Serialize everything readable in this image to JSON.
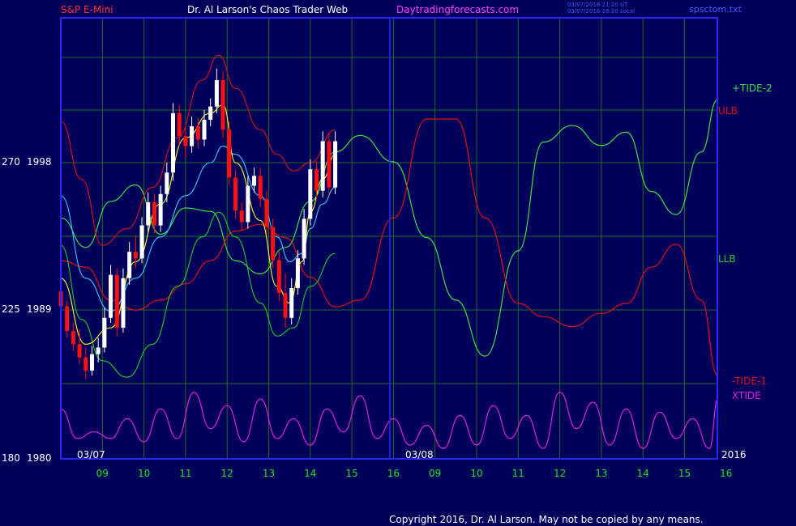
{
  "header": {
    "instrument": "S&P E-Mini",
    "site": "Dr. Al Larson's Chaos Trader Web",
    "url": "Daytradingforecasts.com",
    "update_line1": "03/07/2016 21:20 UT",
    "update_line2": "03/07/2016 16:20 Local",
    "file": "spsctom.txt"
  },
  "copyright": "Copyright 2016, Dr. Al Larson. May not be copied by any means.",
  "colors": {
    "background": "#00005a",
    "frame": "#2828ff",
    "grid": "#1f6f1f",
    "up_bar": "#ffffff",
    "down_bar": "#ff1010",
    "ulb": "#e01010",
    "llb": "#20d020",
    "tide_plus": "#40e040",
    "tide_minus": "#e01010",
    "xtide": "#e020e0",
    "yellow_ma": "#ffff20",
    "cyan_ma": "#40c8ff",
    "x_tick_text": "#20e020",
    "header_red": "#ff3030",
    "header_white": "#ffffff",
    "header_magenta": "#ff40ff",
    "header_blue": "#4060ff"
  },
  "chart_data": {
    "type": "line",
    "title": "S&P E-Mini",
    "y_axis": {
      "ticks": [
        {
          "left": "270",
          "right": "1998"
        },
        {
          "left": "225",
          "right": "1989"
        },
        {
          "left": "180",
          "right": "1980"
        }
      ]
    },
    "x_axis": {
      "date_labels": [
        "03/07",
        "03/08"
      ],
      "year_label": "2016",
      "hour_ticks": [
        "09",
        "10",
        "11",
        "12",
        "13",
        "14",
        "15",
        "16",
        "09",
        "10",
        "11",
        "12",
        "13",
        "14",
        "15",
        "16"
      ]
    },
    "legend": [
      "+TIDE-2",
      "ULB",
      "LLB",
      "-TIDE-1",
      "XTIDE"
    ],
    "candles": [
      {
        "t": 0.0,
        "o": 1990.2,
        "h": 1990.9,
        "l": 1988.7,
        "c": 1989.3
      },
      {
        "t": 0.15,
        "o": 1989.3,
        "h": 1989.6,
        "l": 1987.4,
        "c": 1987.8
      },
      {
        "t": 0.3,
        "o": 1987.8,
        "h": 1988.3,
        "l": 1986.6,
        "c": 1987.0
      },
      {
        "t": 0.45,
        "o": 1987.0,
        "h": 1987.9,
        "l": 1985.8,
        "c": 1986.2
      },
      {
        "t": 0.6,
        "o": 1986.2,
        "h": 1986.8,
        "l": 1984.9,
        "c": 1985.4
      },
      {
        "t": 0.75,
        "o": 1985.4,
        "h": 1986.9,
        "l": 1985.1,
        "c": 1986.4
      },
      {
        "t": 0.9,
        "o": 1986.4,
        "h": 1987.4,
        "l": 1985.9,
        "c": 1986.8
      },
      {
        "t": 1.05,
        "o": 1986.8,
        "h": 1989.2,
        "l": 1986.5,
        "c": 1988.6
      },
      {
        "t": 1.2,
        "o": 1988.6,
        "h": 1991.8,
        "l": 1988.3,
        "c": 1991.2
      },
      {
        "t": 1.35,
        "o": 1991.2,
        "h": 1991.6,
        "l": 1987.5,
        "c": 1988.0
      },
      {
        "t": 1.5,
        "o": 1988.0,
        "h": 1991.6,
        "l": 1987.7,
        "c": 1991.0
      },
      {
        "t": 1.65,
        "o": 1991.0,
        "h": 1993.2,
        "l": 1990.6,
        "c": 1992.6
      },
      {
        "t": 1.8,
        "o": 1992.6,
        "h": 1993.6,
        "l": 1991.6,
        "c": 1992.2
      },
      {
        "t": 1.95,
        "o": 1992.2,
        "h": 1994.7,
        "l": 1991.9,
        "c": 1994.2
      },
      {
        "t": 2.1,
        "o": 1994.2,
        "h": 1996.2,
        "l": 1993.8,
        "c": 1995.6
      },
      {
        "t": 2.25,
        "o": 1995.6,
        "h": 1996.1,
        "l": 1993.7,
        "c": 1994.2
      },
      {
        "t": 2.4,
        "o": 1994.2,
        "h": 1996.6,
        "l": 1993.8,
        "c": 1996.1
      },
      {
        "t": 2.55,
        "o": 1996.1,
        "h": 1998.0,
        "l": 1995.6,
        "c": 1997.4
      },
      {
        "t": 2.7,
        "o": 1997.4,
        "h": 2001.6,
        "l": 1996.9,
        "c": 2001.0
      },
      {
        "t": 2.85,
        "o": 2001.0,
        "h": 2001.5,
        "l": 1999.0,
        "c": 1999.6
      },
      {
        "t": 3.0,
        "o": 1999.6,
        "h": 2000.1,
        "l": 1998.3,
        "c": 1999.0
      },
      {
        "t": 3.15,
        "o": 1999.0,
        "h": 2000.8,
        "l": 1998.6,
        "c": 2000.2
      },
      {
        "t": 3.3,
        "o": 2000.2,
        "h": 2000.7,
        "l": 1998.9,
        "c": 1999.4
      },
      {
        "t": 3.45,
        "o": 1999.4,
        "h": 2001.2,
        "l": 1999.0,
        "c": 2000.6
      },
      {
        "t": 3.6,
        "o": 2000.6,
        "h": 2001.9,
        "l": 2000.2,
        "c": 2001.4
      },
      {
        "t": 3.75,
        "o": 2001.4,
        "h": 2003.7,
        "l": 2001.0,
        "c": 2003.0
      },
      {
        "t": 3.9,
        "o": 2003.0,
        "h": 2003.5,
        "l": 1999.5,
        "c": 2000.0
      },
      {
        "t": 4.05,
        "o": 2000.0,
        "h": 2000.5,
        "l": 1996.6,
        "c": 1997.1
      },
      {
        "t": 4.2,
        "o": 1997.1,
        "h": 1997.6,
        "l": 1994.6,
        "c": 1995.1
      },
      {
        "t": 4.35,
        "o": 1995.1,
        "h": 1995.6,
        "l": 1993.9,
        "c": 1994.4
      },
      {
        "t": 4.5,
        "o": 1994.4,
        "h": 1997.2,
        "l": 1994.0,
        "c": 1996.6
      },
      {
        "t": 4.65,
        "o": 1996.6,
        "h": 1997.7,
        "l": 1996.2,
        "c": 1997.2
      },
      {
        "t": 4.8,
        "o": 1997.2,
        "h": 1997.7,
        "l": 1995.3,
        "c": 1995.8
      },
      {
        "t": 4.95,
        "o": 1995.8,
        "h": 1996.3,
        "l": 1993.6,
        "c": 1994.1
      },
      {
        "t": 5.1,
        "o": 1994.1,
        "h": 1994.6,
        "l": 1991.6,
        "c": 1992.1
      },
      {
        "t": 5.25,
        "o": 1992.1,
        "h": 1992.6,
        "l": 1989.6,
        "c": 1990.1
      },
      {
        "t": 5.4,
        "o": 1990.1,
        "h": 1991.3,
        "l": 1988.0,
        "c": 1988.6
      },
      {
        "t": 5.55,
        "o": 1988.6,
        "h": 1991.0,
        "l": 1988.2,
        "c": 1990.4
      },
      {
        "t": 5.7,
        "o": 1990.4,
        "h": 1992.7,
        "l": 1990.0,
        "c": 1992.2
      },
      {
        "t": 5.85,
        "o": 1992.2,
        "h": 1995.2,
        "l": 1991.8,
        "c": 1994.6
      },
      {
        "t": 6.0,
        "o": 1994.6,
        "h": 1998.2,
        "l": 1994.2,
        "c": 1997.6
      },
      {
        "t": 6.15,
        "o": 1997.6,
        "h": 1998.1,
        "l": 1995.8,
        "c": 1996.3
      },
      {
        "t": 6.3,
        "o": 1996.3,
        "h": 1999.9,
        "l": 1995.9,
        "c": 1999.3
      },
      {
        "t": 6.45,
        "o": 1999.3,
        "h": 1999.8,
        "l": 1996.0,
        "c": 1996.5
      },
      {
        "t": 6.6,
        "o": 1996.5,
        "h": 1999.9,
        "l": 1996.1,
        "c": 1999.3
      }
    ],
    "ma_fast": {
      "t": [
        0,
        0.6,
        1.2,
        1.8,
        2.4,
        3.0,
        3.6,
        3.9,
        4.2,
        4.8,
        5.2,
        5.5,
        5.8,
        6.0,
        6.3,
        6.6
      ],
      "v": [
        1991.0,
        1987.0,
        1988.0,
        1992.0,
        1995.5,
        1999.5,
        2001.0,
        2001.5,
        1998.0,
        1994.5,
        1990.5,
        1989.5,
        1992.0,
        1995.0,
        1997.0,
        1998.5
      ]
    },
    "ma_slow": {
      "t": [
        0,
        0.6,
        1.2,
        1.8,
        2.4,
        3.0,
        3.6,
        3.9,
        4.2,
        4.8,
        5.2,
        5.5,
        5.8,
        6.0,
        6.3,
        6.6
      ],
      "v": [
        1996.0,
        1991.0,
        1989.0,
        1991.0,
        1993.5,
        1996.0,
        1998.0,
        1999.0,
        1998.5,
        1996.0,
        1993.5,
        1992.0,
        1992.5,
        1994.0,
        1995.5,
        1996.5
      ]
    },
    "ulb": {
      "t": [
        0,
        0.5,
        1.0,
        1.6,
        2.2,
        2.8,
        3.4,
        3.8,
        4.2,
        4.8,
        5.2,
        5.6,
        6.0,
        6.6
      ],
      "v": [
        2000.5,
        1997.0,
        1993.0,
        1994.0,
        1996.5,
        1999.5,
        2003.0,
        2004.5,
        2002.5,
        2000.0,
        1998.5,
        1997.5,
        1998.0,
        2000.0
      ]
    },
    "llb": {
      "t": [
        0,
        0.5,
        1.0,
        1.6,
        2.2,
        2.8,
        3.4,
        3.8,
        4.2,
        4.8,
        5.2,
        5.6,
        6.0,
        6.6
      ],
      "v": [
        1993.0,
        1988.5,
        1986.0,
        1985.0,
        1987.0,
        1990.5,
        1993.5,
        1995.0,
        1993.5,
        1989.5,
        1987.5,
        1988.0,
        1990.5,
        1992.5
      ]
    },
    "tide_plus": {
      "t": [
        0,
        0.6,
        1.2,
        1.8,
        2.4,
        3.0,
        3.6,
        4.2,
        4.8,
        5.4,
        6.0,
        6.6,
        7.2,
        8.0,
        8.8,
        9.5,
        10.2,
        11.0,
        11.6,
        12.3,
        13.0,
        13.6,
        14.2,
        14.8,
        15.4,
        15.8
      ],
      "v": [
        253,
        244,
        258,
        263,
        248,
        256,
        255,
        240,
        236,
        244,
        258,
        273,
        278,
        270,
        247,
        228,
        211,
        243,
        276,
        281,
        275,
        279,
        261,
        254,
        273,
        289
      ]
    },
    "tide_minus": {
      "t": [
        0,
        0.6,
        1.2,
        1.8,
        2.4,
        3.0,
        3.6,
        4.2,
        4.8,
        5.4,
        6.0,
        6.6,
        7.2,
        8.0,
        8.8,
        9.5,
        10.2,
        11.0,
        11.6,
        12.3,
        13.0,
        13.6,
        14.2,
        14.8,
        15.4,
        15.8
      ],
      "v": [
        240,
        238,
        228,
        225,
        228,
        233,
        240,
        249,
        251,
        247,
        235,
        226,
        228,
        253,
        283,
        283,
        253,
        227,
        223,
        220,
        224,
        227,
        238,
        245,
        228,
        205
      ]
    },
    "xtide": {
      "t": [
        0,
        0.4,
        0.8,
        1.2,
        1.6,
        2.0,
        2.4,
        2.8,
        3.2,
        3.6,
        4.0,
        4.4,
        4.8,
        5.2,
        5.6,
        6.0,
        6.4,
        6.8,
        7.2,
        7.6,
        8.0,
        8.4,
        8.8,
        9.2,
        9.6,
        10.0,
        10.4,
        10.8,
        11.2,
        11.6,
        12.0,
        12.4,
        12.8,
        13.2,
        13.6,
        14.0,
        14.4,
        14.8,
        15.2,
        15.6,
        15.8
      ],
      "v": [
        195,
        186,
        188,
        186,
        192,
        185,
        195,
        186,
        200,
        189,
        196,
        185,
        198,
        186,
        192,
        184,
        195,
        188,
        199,
        186,
        192,
        184,
        190,
        183,
        193,
        184,
        196,
        186,
        193,
        183,
        200,
        189,
        197,
        184,
        195,
        183,
        194,
        186,
        192,
        183,
        198
      ]
    }
  }
}
